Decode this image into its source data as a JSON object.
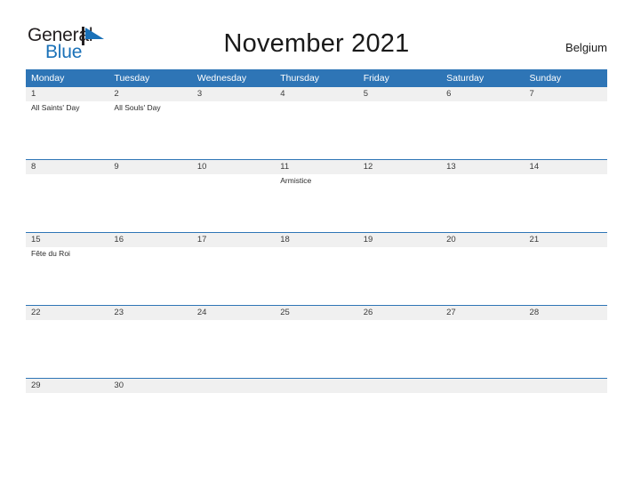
{
  "brand": {
    "name_part1": "General",
    "name_part2": "Blue",
    "flag_icon": "blue-triangle-flag",
    "color_dark": "#231f20",
    "color_blue": "#1a71b8"
  },
  "header": {
    "title": "November 2021",
    "region": "Belgium"
  },
  "calendar": {
    "accent_color": "#2e75b6",
    "daynum_band_color": "#f0f0f0",
    "weekday_headers": [
      "Monday",
      "Tuesday",
      "Wednesday",
      "Thursday",
      "Friday",
      "Saturday",
      "Sunday"
    ],
    "weeks": [
      {
        "days": [
          {
            "num": "1",
            "events": [
              "All Saints' Day"
            ]
          },
          {
            "num": "2",
            "events": [
              "All Souls' Day"
            ]
          },
          {
            "num": "3",
            "events": []
          },
          {
            "num": "4",
            "events": []
          },
          {
            "num": "5",
            "events": []
          },
          {
            "num": "6",
            "events": []
          },
          {
            "num": "7",
            "events": []
          }
        ]
      },
      {
        "days": [
          {
            "num": "8",
            "events": []
          },
          {
            "num": "9",
            "events": []
          },
          {
            "num": "10",
            "events": []
          },
          {
            "num": "11",
            "events": [
              "Armistice"
            ]
          },
          {
            "num": "12",
            "events": []
          },
          {
            "num": "13",
            "events": []
          },
          {
            "num": "14",
            "events": []
          }
        ]
      },
      {
        "days": [
          {
            "num": "15",
            "events": [
              "Fête du Roi"
            ]
          },
          {
            "num": "16",
            "events": []
          },
          {
            "num": "17",
            "events": []
          },
          {
            "num": "18",
            "events": []
          },
          {
            "num": "19",
            "events": []
          },
          {
            "num": "20",
            "events": []
          },
          {
            "num": "21",
            "events": []
          }
        ]
      },
      {
        "days": [
          {
            "num": "22",
            "events": []
          },
          {
            "num": "23",
            "events": []
          },
          {
            "num": "24",
            "events": []
          },
          {
            "num": "25",
            "events": []
          },
          {
            "num": "26",
            "events": []
          },
          {
            "num": "27",
            "events": []
          },
          {
            "num": "28",
            "events": []
          }
        ]
      },
      {
        "days": [
          {
            "num": "29",
            "events": []
          },
          {
            "num": "30",
            "events": []
          },
          {
            "num": "",
            "events": []
          },
          {
            "num": "",
            "events": []
          },
          {
            "num": "",
            "events": []
          },
          {
            "num": "",
            "events": []
          },
          {
            "num": "",
            "events": []
          }
        ]
      }
    ]
  }
}
